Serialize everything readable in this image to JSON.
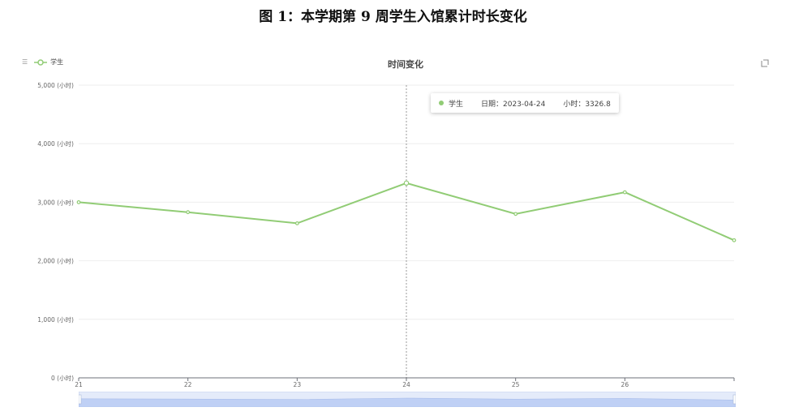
{
  "figure_title": "图 1：本学期第 9 周学生入馆累计时长变化",
  "toolbar": {
    "restore_icon": "restore-icon"
  },
  "tooltip": {
    "series": "学生",
    "date_label": "日期：2023-04-24",
    "value_label": "小时：3326.8"
  },
  "chart_data": {
    "type": "line",
    "title": "时间变化",
    "legend": {
      "position": "top-left",
      "entries": [
        "学生"
      ]
    },
    "xlabel": "",
    "ylabel": "",
    "x_tick_labels": [
      "21",
      "22",
      "23",
      "24",
      "25",
      "26"
    ],
    "y_tick_labels": [
      "0 (小时)",
      "1,000 (小时)",
      "2,000 (小时)",
      "3,000 (小时)",
      "4,000 (小时)",
      "5,000 (小时)"
    ],
    "ylim": [
      0,
      5000
    ],
    "xlim": [
      21,
      27
    ],
    "grid": true,
    "x": [
      "2023-04-21",
      "2023-04-22",
      "2023-04-23",
      "2023-04-24",
      "2023-04-25",
      "2023-04-26",
      "2023-04-27"
    ],
    "series": [
      {
        "name": "学生",
        "color": "#91cc75",
        "values": [
          3000,
          2830,
          2640,
          3326.8,
          2800,
          3170,
          2350
        ]
      }
    ],
    "highlight_index": 3,
    "data_zoom": true
  }
}
